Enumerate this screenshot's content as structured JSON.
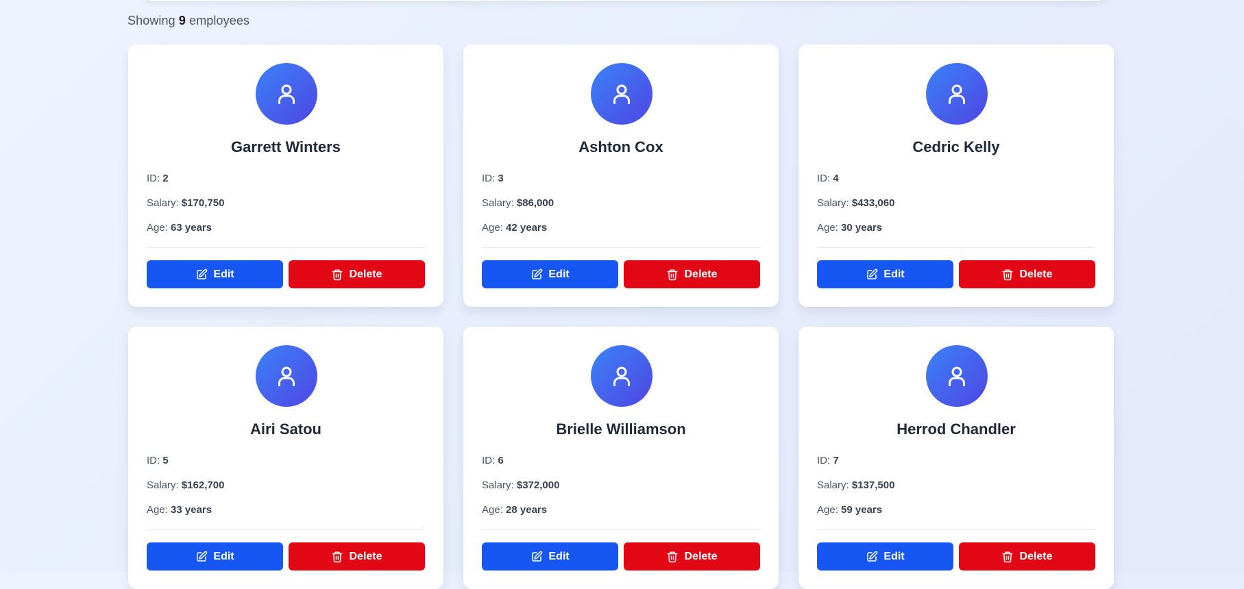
{
  "summary": {
    "prefix": "Showing",
    "count": "9",
    "suffix": "employees"
  },
  "labels": {
    "id": "ID:",
    "salary": "Salary:",
    "age": "Age:"
  },
  "actions": {
    "edit": "Edit",
    "delete": "Delete"
  },
  "employees": [
    {
      "name": "Garrett Winters",
      "id": "2",
      "salary": "$170,750",
      "age": "63 years"
    },
    {
      "name": "Ashton Cox",
      "id": "3",
      "salary": "$86,000",
      "age": "42 years"
    },
    {
      "name": "Cedric Kelly",
      "id": "4",
      "salary": "$433,060",
      "age": "30 years"
    },
    {
      "name": "Airi Satou",
      "id": "5",
      "salary": "$162,700",
      "age": "33 years"
    },
    {
      "name": "Brielle Williamson",
      "id": "6",
      "salary": "$372,000",
      "age": "28 years"
    },
    {
      "name": "Herrod Chandler",
      "id": "7",
      "salary": "$137,500",
      "age": "59 years"
    }
  ],
  "colors": {
    "edit": "#1657f4",
    "delete": "#e20714",
    "avatar_start": "#3b82f6",
    "avatar_end": "#4f46e5"
  },
  "icons": {
    "avatar": "user-icon",
    "edit": "edit-icon",
    "delete": "trash-icon"
  }
}
